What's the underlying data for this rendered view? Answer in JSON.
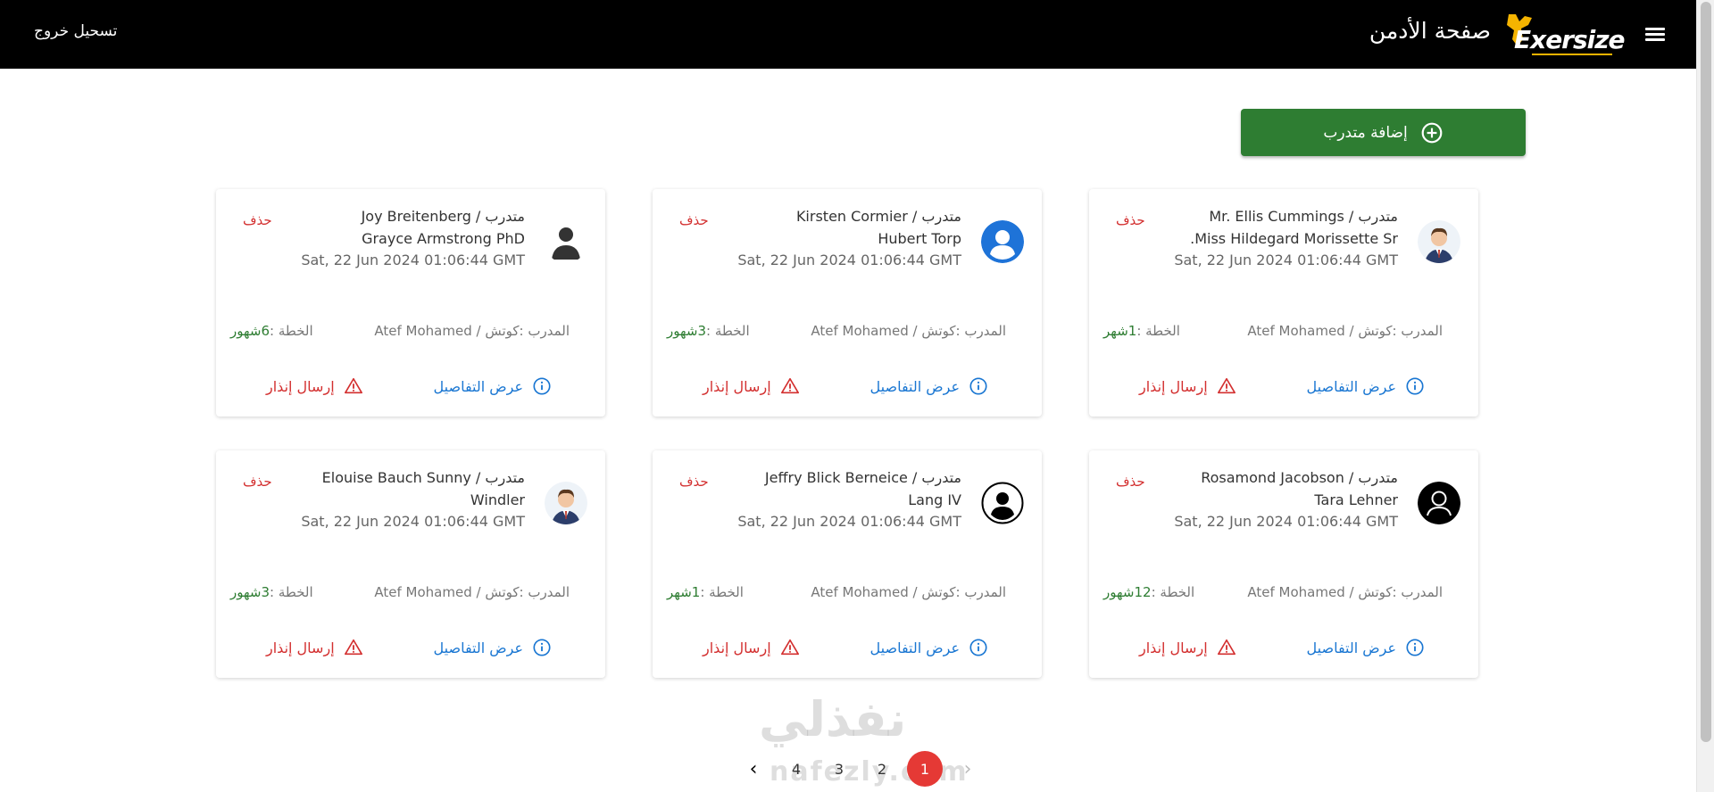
{
  "header": {
    "logo_text": "Exersize",
    "page_title": "صفحة الأدمن",
    "logout_label": "تسحيل خروج"
  },
  "add_button": {
    "label": "إضافة متدرب"
  },
  "cards": [
    {
      "name": "متدرب / Mr. Ellis Cummings Miss Hildegard Morissette Sr.",
      "date": "Sat, 22 Jun 2024 01:06:44 GMT",
      "delete": "حذف",
      "coach_label": "المدرب :",
      "coach": "كوتش / Atef Mohamed",
      "plan_label": "الخطة :",
      "plan": "1شهر",
      "view": "عرض التفاصيل",
      "warn": "إرسال إنذار",
      "avatar": "man-avatar"
    },
    {
      "name": "متدرب / Kirsten Cormier Hubert Torp",
      "date": "Sat, 22 Jun 2024 01:06:44 GMT",
      "delete": "حذف",
      "coach_label": "المدرب :",
      "coach": "كوتش / Atef Mohamed",
      "plan_label": "الخطة :",
      "plan": "3شهور",
      "view": "عرض التفاصيل",
      "warn": "إرسال إنذار",
      "avatar": "blue-person-avatar"
    },
    {
      "name": "متدرب / Joy Breitenberg Grayce Armstrong PhD",
      "date": "Sat, 22 Jun 2024 01:06:44 GMT",
      "delete": "حذف",
      "coach_label": "المدرب :",
      "coach": "كوتش / Atef Mohamed",
      "plan_label": "الخطة :",
      "plan": "6شهور",
      "view": "عرض التفاصيل",
      "warn": "إرسال إنذار",
      "avatar": "dark-person-avatar"
    },
    {
      "name": "متدرب / Rosamond Jacobson Tara Lehner",
      "date": "Sat, 22 Jun 2024 01:06:44 GMT",
      "delete": "حذف",
      "coach_label": "المدرب :",
      "coach": "كوتش / Atef Mohamed",
      "plan_label": "الخطة :",
      "plan": "12شهور",
      "view": "عرض التفاصيل",
      "warn": "إرسال إنذار",
      "avatar": "black-user-avatar"
    },
    {
      "name": "متدرب / Jeffry Blick Berneice Lang IV",
      "date": "Sat, 22 Jun 2024 01:06:44 GMT",
      "delete": "حذف",
      "coach_label": "المدرب :",
      "coach": "كوتش / Atef Mohamed",
      "plan_label": "الخطة :",
      "plan": "1شهر",
      "view": "عرض التفاصيل",
      "warn": "إرسال إنذار",
      "avatar": "outline-user-avatar"
    },
    {
      "name": "متدرب / Elouise Bauch Sunny Windler",
      "date": "Sat, 22 Jun 2024 01:06:44 GMT",
      "delete": "حذف",
      "coach_label": "المدرب :",
      "coach": "كوتش / Atef Mohamed",
      "plan_label": "الخطة :",
      "plan": "3شهور",
      "view": "عرض التفاصيل",
      "warn": "إرسال إنذار",
      "avatar": "man-avatar"
    }
  ],
  "pagination": {
    "pages": [
      "1",
      "2",
      "3",
      "4"
    ],
    "active": "1"
  },
  "watermark": {
    "arabic": "نفذلي",
    "latin": "nafezly.com"
  },
  "colors": {
    "header_bg": "#000000",
    "add_button": "#2e7d32",
    "delete": "#d32f2f",
    "view": "#1976d2",
    "plan": "#2e7d32",
    "active_page": "#e53935"
  }
}
